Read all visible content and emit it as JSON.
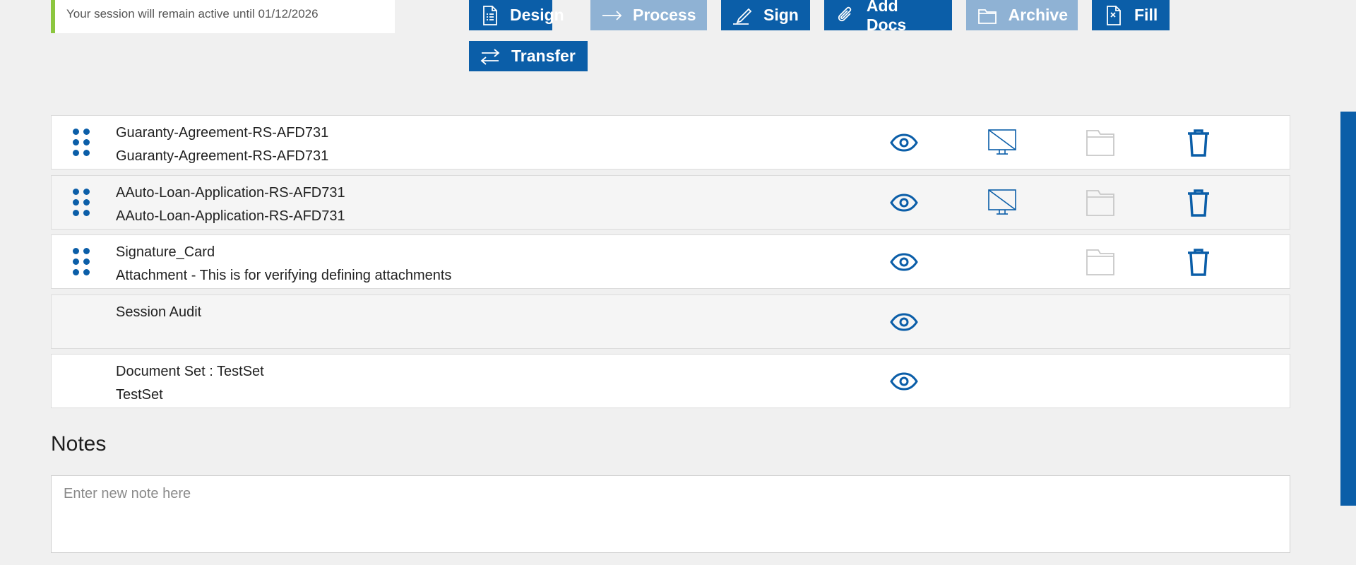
{
  "session": {
    "message": "Your session will remain active until 01/12/2026"
  },
  "toolbar": {
    "design": "Design",
    "process": "Process",
    "sign": "Sign",
    "add_docs": "Add Docs",
    "archive": "Archive",
    "fill": "Fill",
    "transfer": "Transfer",
    "disabled": [
      "Process",
      "Archive"
    ]
  },
  "documents": [
    {
      "title": "Guaranty-Agreement-RS-AFD731",
      "subtitle": "Guaranty-Agreement-RS-AFD731"
    },
    {
      "title": "AAuto-Loan-Application-RS-AFD731",
      "subtitle": "AAuto-Loan-Application-RS-AFD731"
    },
    {
      "title": "Signature_Card",
      "subtitle": "Attachment - This is for verifying defining attachments"
    },
    {
      "title": "Session Audit",
      "subtitle": ""
    },
    {
      "title": "Document Set : TestSet",
      "subtitle": "TestSet"
    }
  ],
  "notes": {
    "heading": "Notes",
    "placeholder": "Enter new note here"
  },
  "colors": {
    "accent": "#0b5ea8",
    "accent_disabled": "#8fb2d4",
    "banner_bar": "#8cc63f",
    "folder_disabled": "#c8c8c8"
  },
  "icons": {
    "design": "document-list-icon",
    "process": "arrow-right-icon",
    "sign": "pen-icon",
    "add_docs": "paperclip-icon",
    "archive": "folder-icon",
    "fill": "form-fill-icon",
    "transfer": "transfer-arrows-icon",
    "row": [
      "drag-handle-icon",
      "eye-icon",
      "monitor-off-icon",
      "folder-icon",
      "trash-icon"
    ]
  }
}
